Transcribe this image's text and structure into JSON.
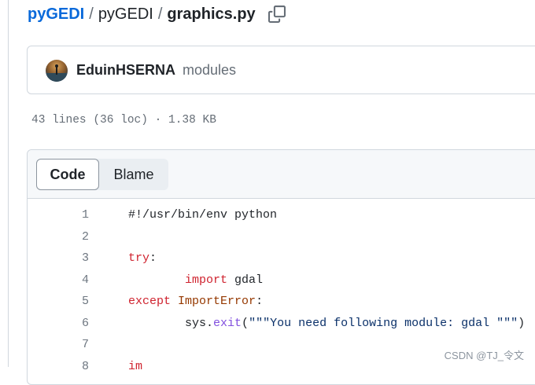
{
  "breadcrumb": {
    "owner": "pyGEDI",
    "repo": "pyGEDI",
    "separator": "/",
    "file": "graphics.py"
  },
  "commit": {
    "author": "EduinHSERNA",
    "message": "modules"
  },
  "file_meta": "43 lines (36 loc) · 1.38 KB",
  "tabs": {
    "code": "Code",
    "blame": "Blame"
  },
  "code_lines": [
    {
      "n": "1",
      "tokens": [
        {
          "t": "#!/usr/bin/env python",
          "c": "plain"
        }
      ]
    },
    {
      "n": "2",
      "tokens": []
    },
    {
      "n": "3",
      "tokens": [
        {
          "t": "try",
          "c": "kw"
        },
        {
          "t": ":",
          "c": "plain"
        }
      ]
    },
    {
      "n": "4",
      "tokens": [
        {
          "t": "        ",
          "c": "plain"
        },
        {
          "t": "import",
          "c": "kw"
        },
        {
          "t": " gdal",
          "c": "plain"
        }
      ]
    },
    {
      "n": "5",
      "tokens": [
        {
          "t": "except",
          "c": "kw"
        },
        {
          "t": " ",
          "c": "plain"
        },
        {
          "t": "ImportError",
          "c": "cls"
        },
        {
          "t": ":",
          "c": "plain"
        }
      ]
    },
    {
      "n": "6",
      "tokens": [
        {
          "t": "        sys.",
          "c": "plain"
        },
        {
          "t": "exit",
          "c": "fn"
        },
        {
          "t": "(",
          "c": "plain"
        },
        {
          "t": "\"\"\"You need following module: gdal \"\"\"",
          "c": "str"
        },
        {
          "t": ")",
          "c": "plain"
        }
      ]
    },
    {
      "n": "7",
      "tokens": []
    },
    {
      "n": "8",
      "tokens": [
        {
          "t": "im",
          "c": "kw"
        }
      ]
    }
  ],
  "watermark": "CSDN @TJ_令文",
  "colors": {
    "link": "#0969da",
    "keyword": "#cf222e",
    "function": "#8250df",
    "string": "#0a3069",
    "class": "#953800"
  }
}
